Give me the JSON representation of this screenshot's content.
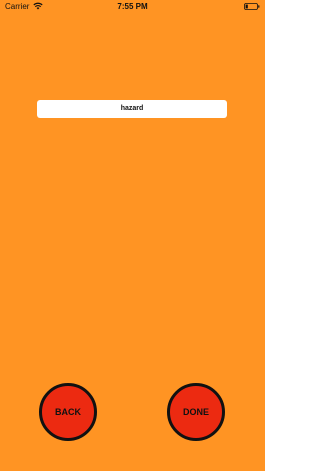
{
  "status_bar": {
    "carrier": "Carrier",
    "time": "7:55 PM",
    "wifi_icon": "wifi-icon",
    "battery_icon": "battery-icon"
  },
  "main": {
    "background_color": "#ff9423",
    "word_field_value": "hazard"
  },
  "buttons": {
    "back_label": "BACK",
    "done_label": "DONE",
    "button_color": "#ec2a11"
  }
}
